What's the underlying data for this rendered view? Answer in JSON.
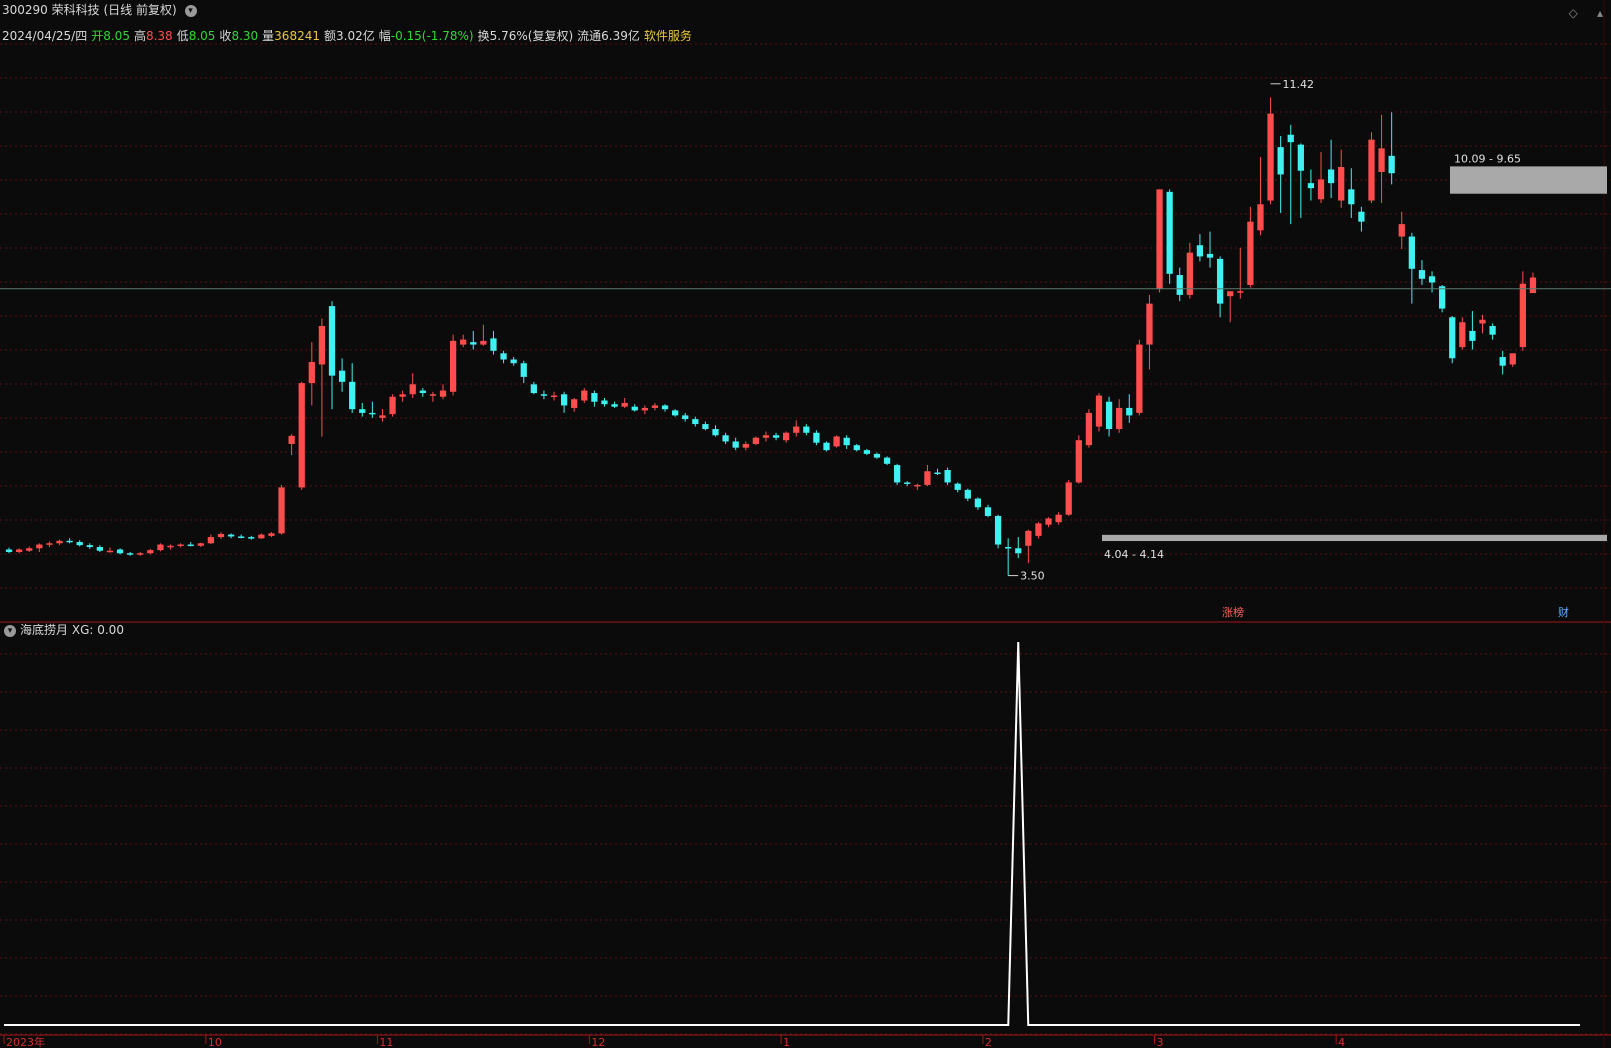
{
  "header": {
    "code": "300290",
    "name": "荣科科技",
    "period": "(日线 前复权)",
    "dropdown_icon": "chevron-down-icon"
  },
  "window_controls": [
    "diamond-icon",
    "collapse-icon"
  ],
  "info": {
    "date": "2024/04/25/四",
    "open_label": "开",
    "open": "8.05",
    "high_label": "高",
    "high": "8.38",
    "low_label": "低",
    "low": "8.05",
    "close_label": "收",
    "close": "8.30",
    "volume_label": "量",
    "volume": "368241",
    "amount_label": "额",
    "amount": "3.02亿",
    "change_label": "幅",
    "change": "-0.15(-1.78%)",
    "turnover_label": "换",
    "turnover": "5.76%(复复权)",
    "float_label": "流通",
    "float": "6.39亿",
    "industry": "软件服务"
  },
  "indicator": {
    "name": "海底捞月",
    "value_label": "XG:",
    "value": "0.00",
    "icon": "chevron-down-icon"
  },
  "colors": {
    "up": "#ff4d4d",
    "down": "#3ff1f1",
    "grid": "#5a1010",
    "zone": "#a9a9a9",
    "volume_text": "#e8c83c",
    "green_text": "#33d633"
  },
  "chart_data": [
    {
      "type": "candlestick",
      "x": "date",
      "ylim": [
        3.3,
        11.9
      ],
      "points": [
        {
          "o": 3.92,
          "h": 3.95,
          "l": 3.86,
          "c": 3.88
        },
        {
          "o": 3.88,
          "h": 3.94,
          "l": 3.86,
          "c": 3.92
        },
        {
          "o": 3.9,
          "h": 3.97,
          "l": 3.88,
          "c": 3.94
        },
        {
          "o": 3.94,
          "h": 4.02,
          "l": 3.88,
          "c": 4.0
        },
        {
          "o": 4.0,
          "h": 4.05,
          "l": 3.96,
          "c": 4.02
        },
        {
          "o": 4.02,
          "h": 4.08,
          "l": 3.99,
          "c": 4.06
        },
        {
          "o": 4.06,
          "h": 4.1,
          "l": 4.02,
          "c": 4.04
        },
        {
          "o": 4.04,
          "h": 4.07,
          "l": 3.97,
          "c": 3.99
        },
        {
          "o": 3.99,
          "h": 4.02,
          "l": 3.93,
          "c": 3.96
        },
        {
          "o": 3.96,
          "h": 3.99,
          "l": 3.88,
          "c": 3.9
        },
        {
          "o": 3.9,
          "h": 3.95,
          "l": 3.87,
          "c": 3.9
        },
        {
          "o": 3.92,
          "h": 3.94,
          "l": 3.84,
          "c": 3.86
        },
        {
          "o": 3.86,
          "h": 3.88,
          "l": 3.82,
          "c": 3.84
        },
        {
          "o": 3.84,
          "h": 3.88,
          "l": 3.82,
          "c": 3.86
        },
        {
          "o": 3.86,
          "h": 3.93,
          "l": 3.84,
          "c": 3.91
        },
        {
          "o": 3.91,
          "h": 4.02,
          "l": 3.89,
          "c": 4.0
        },
        {
          "o": 3.96,
          "h": 4.0,
          "l": 3.92,
          "c": 3.98
        },
        {
          "o": 3.98,
          "h": 4.02,
          "l": 3.95,
          "c": 4.0
        },
        {
          "o": 4.0,
          "h": 4.04,
          "l": 3.97,
          "c": 3.99
        },
        {
          "o": 3.98,
          "h": 4.03,
          "l": 3.96,
          "c": 4.02
        },
        {
          "o": 4.02,
          "h": 4.16,
          "l": 4.01,
          "c": 4.12
        },
        {
          "o": 4.12,
          "h": 4.2,
          "l": 4.09,
          "c": 4.17
        },
        {
          "o": 4.16,
          "h": 4.18,
          "l": 4.1,
          "c": 4.13
        },
        {
          "o": 4.13,
          "h": 4.16,
          "l": 4.1,
          "c": 4.12
        },
        {
          "o": 4.12,
          "h": 4.14,
          "l": 4.08,
          "c": 4.1
        },
        {
          "o": 4.1,
          "h": 4.18,
          "l": 4.09,
          "c": 4.16
        },
        {
          "o": 4.14,
          "h": 4.2,
          "l": 4.12,
          "c": 4.18
        },
        {
          "o": 4.18,
          "h": 4.96,
          "l": 4.16,
          "c": 4.92
        },
        {
          "o": 5.62,
          "h": 5.78,
          "l": 5.44,
          "c": 5.75
        },
        {
          "o": 4.92,
          "h": 6.62,
          "l": 4.88,
          "c": 6.6
        },
        {
          "o": 6.6,
          "h": 7.26,
          "l": 6.24,
          "c": 6.94
        },
        {
          "o": 6.9,
          "h": 7.64,
          "l": 5.74,
          "c": 7.52
        },
        {
          "o": 7.84,
          "h": 7.92,
          "l": 6.18,
          "c": 6.72
        },
        {
          "o": 6.8,
          "h": 7.0,
          "l": 6.46,
          "c": 6.62
        },
        {
          "o": 6.62,
          "h": 6.92,
          "l": 6.12,
          "c": 6.18
        },
        {
          "o": 6.18,
          "h": 6.28,
          "l": 6.06,
          "c": 6.12
        },
        {
          "o": 6.12,
          "h": 6.3,
          "l": 6.04,
          "c": 6.1
        },
        {
          "o": 6.04,
          "h": 6.18,
          "l": 5.98,
          "c": 6.08
        },
        {
          "o": 6.1,
          "h": 6.42,
          "l": 6.06,
          "c": 6.38
        },
        {
          "o": 6.38,
          "h": 6.48,
          "l": 6.3,
          "c": 6.42
        },
        {
          "o": 6.42,
          "h": 6.76,
          "l": 6.36,
          "c": 6.58
        },
        {
          "o": 6.48,
          "h": 6.52,
          "l": 6.38,
          "c": 6.44
        },
        {
          "o": 6.42,
          "h": 6.46,
          "l": 6.3,
          "c": 6.42
        },
        {
          "o": 6.38,
          "h": 6.58,
          "l": 6.34,
          "c": 6.48
        },
        {
          "o": 6.46,
          "h": 7.38,
          "l": 6.4,
          "c": 7.28
        },
        {
          "o": 7.22,
          "h": 7.38,
          "l": 7.18,
          "c": 7.3
        },
        {
          "o": 7.26,
          "h": 7.44,
          "l": 7.14,
          "c": 7.22
        },
        {
          "o": 7.22,
          "h": 7.54,
          "l": 7.2,
          "c": 7.28
        },
        {
          "o": 7.32,
          "h": 7.44,
          "l": 7.06,
          "c": 7.12
        },
        {
          "o": 7.08,
          "h": 7.12,
          "l": 6.92,
          "c": 6.98
        },
        {
          "o": 6.98,
          "h": 7.02,
          "l": 6.88,
          "c": 6.92
        },
        {
          "o": 6.92,
          "h": 6.96,
          "l": 6.6,
          "c": 6.7
        },
        {
          "o": 6.58,
          "h": 6.62,
          "l": 6.42,
          "c": 6.44
        },
        {
          "o": 6.42,
          "h": 6.48,
          "l": 6.34,
          "c": 6.4
        },
        {
          "o": 6.4,
          "h": 6.46,
          "l": 6.32,
          "c": 6.4
        },
        {
          "o": 6.42,
          "h": 6.46,
          "l": 6.12,
          "c": 6.24
        },
        {
          "o": 6.2,
          "h": 6.36,
          "l": 6.14,
          "c": 6.34
        },
        {
          "o": 6.32,
          "h": 6.52,
          "l": 6.28,
          "c": 6.48
        },
        {
          "o": 6.44,
          "h": 6.48,
          "l": 6.22,
          "c": 6.3
        },
        {
          "o": 6.32,
          "h": 6.36,
          "l": 6.22,
          "c": 6.26
        },
        {
          "o": 6.26,
          "h": 6.3,
          "l": 6.2,
          "c": 6.22
        },
        {
          "o": 6.22,
          "h": 6.36,
          "l": 6.2,
          "c": 6.28
        },
        {
          "o": 6.22,
          "h": 6.26,
          "l": 6.14,
          "c": 6.16
        },
        {
          "o": 6.16,
          "h": 6.24,
          "l": 6.1,
          "c": 6.2
        },
        {
          "o": 6.2,
          "h": 6.28,
          "l": 6.16,
          "c": 6.24
        },
        {
          "o": 6.24,
          "h": 6.26,
          "l": 6.14,
          "c": 6.18
        },
        {
          "o": 6.16,
          "h": 6.18,
          "l": 6.06,
          "c": 6.08
        },
        {
          "o": 6.08,
          "h": 6.12,
          "l": 5.98,
          "c": 6.02
        },
        {
          "o": 6.02,
          "h": 6.06,
          "l": 5.9,
          "c": 5.94
        },
        {
          "o": 5.94,
          "h": 5.98,
          "l": 5.84,
          "c": 5.86
        },
        {
          "o": 5.86,
          "h": 5.92,
          "l": 5.74,
          "c": 5.76
        },
        {
          "o": 5.76,
          "h": 5.8,
          "l": 5.62,
          "c": 5.66
        },
        {
          "o": 5.66,
          "h": 5.72,
          "l": 5.52,
          "c": 5.56
        },
        {
          "o": 5.56,
          "h": 5.66,
          "l": 5.52,
          "c": 5.62
        },
        {
          "o": 5.62,
          "h": 5.74,
          "l": 5.6,
          "c": 5.72
        },
        {
          "o": 5.72,
          "h": 5.82,
          "l": 5.66,
          "c": 5.76
        },
        {
          "o": 5.76,
          "h": 5.8,
          "l": 5.68,
          "c": 5.72
        },
        {
          "o": 5.68,
          "h": 5.82,
          "l": 5.64,
          "c": 5.8
        },
        {
          "o": 5.8,
          "h": 6.0,
          "l": 5.74,
          "c": 5.9
        },
        {
          "o": 5.9,
          "h": 5.94,
          "l": 5.76,
          "c": 5.8
        },
        {
          "o": 5.8,
          "h": 5.84,
          "l": 5.6,
          "c": 5.64
        },
        {
          "o": 5.64,
          "h": 5.66,
          "l": 5.5,
          "c": 5.52
        },
        {
          "o": 5.58,
          "h": 5.76,
          "l": 5.56,
          "c": 5.74
        },
        {
          "o": 5.72,
          "h": 5.76,
          "l": 5.54,
          "c": 5.6
        },
        {
          "o": 5.6,
          "h": 5.62,
          "l": 5.5,
          "c": 5.52
        },
        {
          "o": 5.52,
          "h": 5.54,
          "l": 5.44,
          "c": 5.46
        },
        {
          "o": 5.46,
          "h": 5.48,
          "l": 5.38,
          "c": 5.4
        },
        {
          "o": 5.4,
          "h": 5.42,
          "l": 5.28,
          "c": 5.3
        },
        {
          "o": 5.28,
          "h": 5.3,
          "l": 4.96,
          "c": 5.0
        },
        {
          "o": 5.0,
          "h": 5.02,
          "l": 4.94,
          "c": 4.98
        },
        {
          "o": 4.94,
          "h": 4.98,
          "l": 4.88,
          "c": 4.96
        },
        {
          "o": 4.96,
          "h": 5.28,
          "l": 4.94,
          "c": 5.18
        },
        {
          "o": 5.16,
          "h": 5.22,
          "l": 5.12,
          "c": 5.14
        },
        {
          "o": 5.2,
          "h": 5.24,
          "l": 4.96,
          "c": 5.0
        },
        {
          "o": 4.98,
          "h": 5.0,
          "l": 4.84,
          "c": 4.88
        },
        {
          "o": 4.88,
          "h": 4.9,
          "l": 4.7,
          "c": 4.74
        },
        {
          "o": 4.74,
          "h": 4.76,
          "l": 4.56,
          "c": 4.6
        },
        {
          "o": 4.6,
          "h": 4.64,
          "l": 4.44,
          "c": 4.46
        },
        {
          "o": 4.46,
          "h": 4.48,
          "l": 3.94,
          "c": 4.0
        },
        {
          "o": 3.96,
          "h": 4.1,
          "l": 3.5,
          "c": 3.94
        },
        {
          "o": 3.94,
          "h": 4.12,
          "l": 3.78,
          "c": 3.86
        },
        {
          "o": 3.98,
          "h": 4.24,
          "l": 3.7,
          "c": 4.22
        },
        {
          "o": 4.14,
          "h": 4.36,
          "l": 4.1,
          "c": 4.34
        },
        {
          "o": 4.32,
          "h": 4.44,
          "l": 4.28,
          "c": 4.42
        },
        {
          "o": 4.36,
          "h": 4.52,
          "l": 4.32,
          "c": 4.48
        },
        {
          "o": 4.48,
          "h": 5.04,
          "l": 4.46,
          "c": 5.0
        },
        {
          "o": 5.0,
          "h": 5.76,
          "l": 4.98,
          "c": 5.68
        },
        {
          "o": 5.6,
          "h": 6.18,
          "l": 5.56,
          "c": 6.12
        },
        {
          "o": 5.9,
          "h": 6.44,
          "l": 5.82,
          "c": 6.4
        },
        {
          "o": 6.3,
          "h": 6.38,
          "l": 5.74,
          "c": 5.86
        },
        {
          "o": 5.86,
          "h": 6.34,
          "l": 5.8,
          "c": 6.2
        },
        {
          "o": 6.2,
          "h": 6.42,
          "l": 5.96,
          "c": 6.08
        },
        {
          "o": 6.12,
          "h": 7.3,
          "l": 6.08,
          "c": 7.22
        },
        {
          "o": 7.22,
          "h": 8.02,
          "l": 6.82,
          "c": 7.88
        },
        {
          "o": 8.12,
          "h": 9.72,
          "l": 8.06,
          "c": 9.72
        },
        {
          "o": 9.68,
          "h": 9.72,
          "l": 8.2,
          "c": 8.36
        },
        {
          "o": 8.34,
          "h": 8.46,
          "l": 7.92,
          "c": 8.02
        },
        {
          "o": 8.02,
          "h": 8.86,
          "l": 7.96,
          "c": 8.7
        },
        {
          "o": 8.82,
          "h": 9.0,
          "l": 8.56,
          "c": 8.64
        },
        {
          "o": 8.68,
          "h": 9.04,
          "l": 8.46,
          "c": 8.62
        },
        {
          "o": 8.6,
          "h": 8.64,
          "l": 7.66,
          "c": 7.88
        },
        {
          "o": 8.0,
          "h": 8.04,
          "l": 7.58,
          "c": 8.08
        },
        {
          "o": 8.08,
          "h": 8.78,
          "l": 7.96,
          "c": 8.08
        },
        {
          "o": 8.18,
          "h": 9.44,
          "l": 8.14,
          "c": 9.2
        },
        {
          "o": 9.06,
          "h": 10.24,
          "l": 8.98,
          "c": 9.48
        },
        {
          "o": 9.54,
          "h": 11.2,
          "l": 9.48,
          "c": 10.94
        },
        {
          "o": 10.4,
          "h": 10.58,
          "l": 9.34,
          "c": 9.96
        },
        {
          "o": 10.6,
          "h": 10.76,
          "l": 9.16,
          "c": 10.48
        },
        {
          "o": 10.44,
          "h": 10.46,
          "l": 9.26,
          "c": 10.02
        },
        {
          "o": 9.82,
          "h": 10.04,
          "l": 9.54,
          "c": 9.74
        },
        {
          "o": 9.56,
          "h": 10.32,
          "l": 9.5,
          "c": 9.88
        },
        {
          "o": 10.04,
          "h": 10.52,
          "l": 9.58,
          "c": 9.82
        },
        {
          "o": 9.54,
          "h": 10.36,
          "l": 9.42,
          "c": 10.08
        },
        {
          "o": 9.72,
          "h": 10.06,
          "l": 9.26,
          "c": 9.48
        },
        {
          "o": 9.36,
          "h": 9.44,
          "l": 9.04,
          "c": 9.2
        },
        {
          "o": 9.54,
          "h": 10.64,
          "l": 9.5,
          "c": 10.52
        },
        {
          "o": 10.0,
          "h": 10.92,
          "l": 9.5,
          "c": 10.38
        },
        {
          "o": 10.26,
          "h": 10.96,
          "l": 9.8,
          "c": 9.98
        },
        {
          "o": 8.96,
          "h": 9.36,
          "l": 8.76,
          "c": 9.16
        },
        {
          "o": 8.96,
          "h": 9.02,
          "l": 7.88,
          "c": 8.44
        },
        {
          "o": 8.42,
          "h": 8.58,
          "l": 8.18,
          "c": 8.28
        },
        {
          "o": 8.32,
          "h": 8.4,
          "l": 8.06,
          "c": 8.22
        },
        {
          "o": 8.16,
          "h": 8.18,
          "l": 7.74,
          "c": 7.8
        },
        {
          "o": 7.66,
          "h": 7.68,
          "l": 6.92,
          "c": 7.0
        },
        {
          "o": 7.18,
          "h": 7.66,
          "l": 7.14,
          "c": 7.58
        },
        {
          "o": 7.44,
          "h": 7.76,
          "l": 7.14,
          "c": 7.28
        },
        {
          "o": 7.56,
          "h": 7.7,
          "l": 7.4,
          "c": 7.62
        },
        {
          "o": 7.52,
          "h": 7.56,
          "l": 7.3,
          "c": 7.38
        },
        {
          "o": 7.02,
          "h": 7.12,
          "l": 6.74,
          "c": 6.88
        },
        {
          "o": 6.9,
          "h": 7.04,
          "l": 6.86,
          "c": 7.08
        },
        {
          "o": 7.18,
          "h": 8.4,
          "l": 7.12,
          "c": 8.2
        },
        {
          "o": 8.05,
          "h": 8.38,
          "l": 8.05,
          "c": 8.3
        }
      ],
      "annotations": [
        "11.42",
        "10.09 - 9.65",
        "4.04 - 4.14",
        "3.50"
      ],
      "horizontal_line": 8.12,
      "zones": [
        {
          "label": "10.09 - 9.65",
          "low": 9.65,
          "high": 10.09
        },
        {
          "label": "4.04 - 4.14",
          "low": 4.04,
          "high": 4.14
        }
      ],
      "event_markers": [
        "涨榜",
        "财"
      ],
      "x_tick_labels": [
        "2023年",
        "10",
        "11",
        "12",
        "1",
        "2",
        "3",
        "4"
      ],
      "grid": true
    },
    {
      "type": "line",
      "name": "XG",
      "ylim": [
        0,
        1
      ],
      "series": [
        {
          "name": "XG",
          "pulse_at_index": 100,
          "pulse_value": 1.0,
          "baseline": 0
        }
      ]
    }
  ]
}
